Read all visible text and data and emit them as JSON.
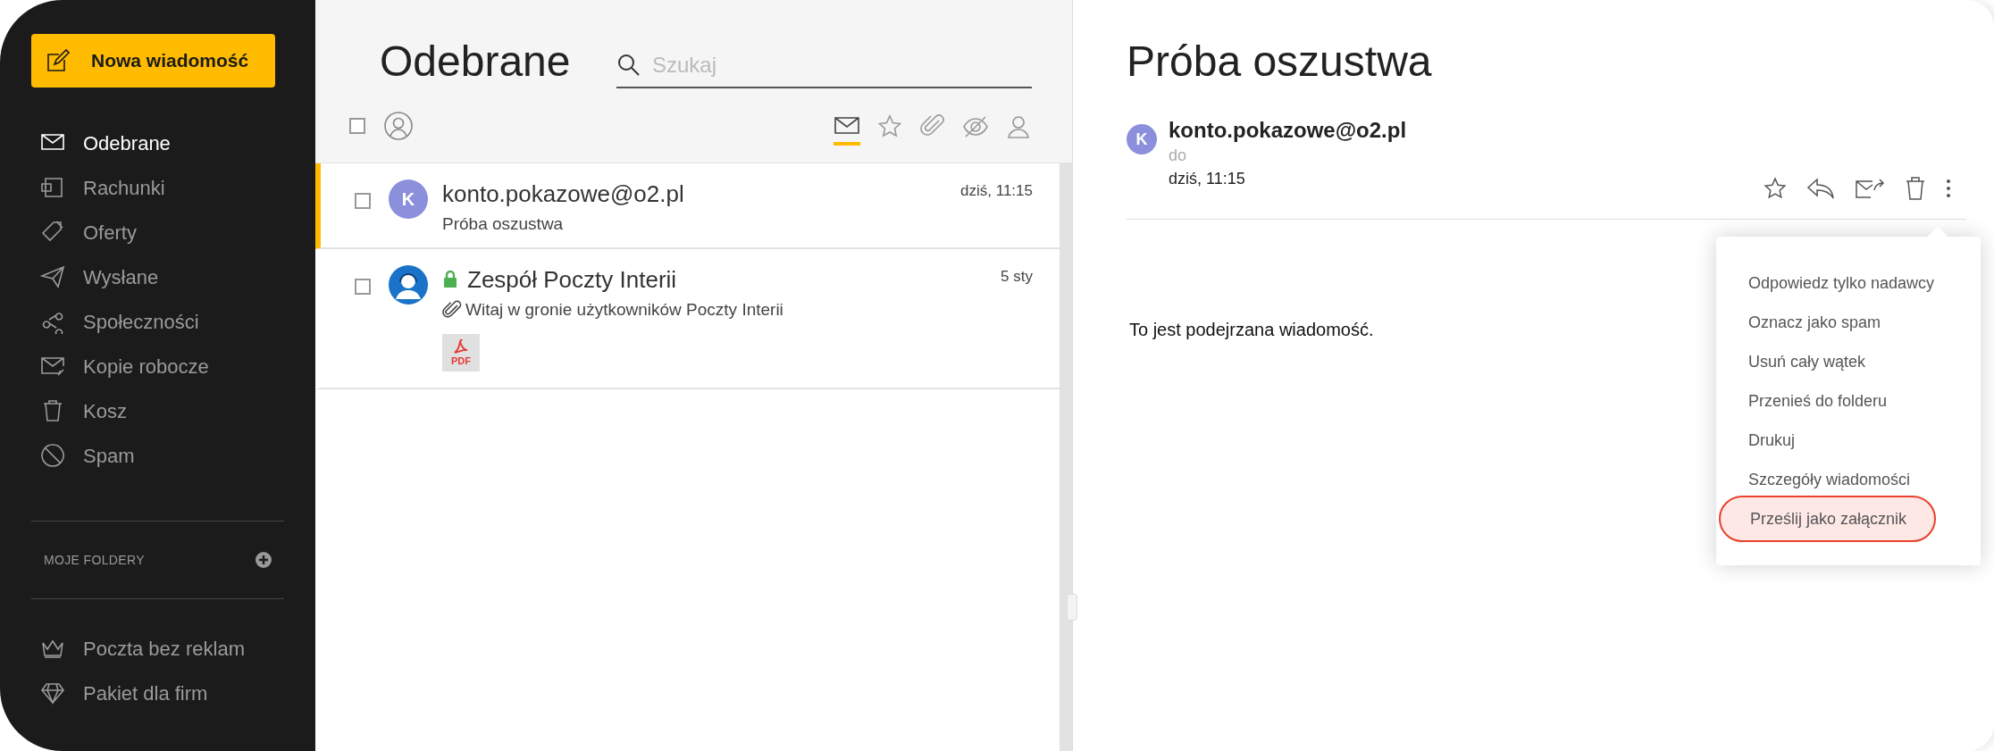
{
  "sidebar": {
    "compose_button": "Nowa wiadomość",
    "items": [
      {
        "label": "Odebrane",
        "selected": true
      },
      {
        "label": "Rachunki",
        "selected": false
      },
      {
        "label": "Oferty",
        "selected": false
      },
      {
        "label": "Wysłane",
        "selected": false
      },
      {
        "label": "Społeczności",
        "selected": false
      },
      {
        "label": "Kopie robocze",
        "selected": false
      },
      {
        "label": "Kosz",
        "selected": false
      },
      {
        "label": "Spam",
        "selected": false
      }
    ],
    "folders_heading": "MOJE FOLDERY",
    "extras": [
      {
        "label": "Poczta bez reklam"
      },
      {
        "label": "Pakiet dla firm"
      }
    ]
  },
  "message_list": {
    "title": "Odebrane",
    "search": {
      "placeholder": "Szukaj"
    },
    "select_all": {
      "checked": false
    },
    "filters": [
      {
        "selected": true
      },
      {
        "selected": false
      },
      {
        "selected": false
      },
      {
        "selected": false
      },
      {
        "selected": false
      }
    ],
    "messages": [
      {
        "sender": "konto.pokazowe@o2.pl",
        "subject": "Próba oszustwa",
        "date": "dziś, 11:15",
        "selected": true,
        "checked": false,
        "avatar_letter": "K",
        "secure": false,
        "has_attachment": false
      },
      {
        "sender": "Zespół Poczty Interii",
        "subject": "Witaj w gronie użytkowników Poczty Interii",
        "date": "5 sty",
        "selected": false,
        "checked": false,
        "secure": true,
        "has_attachment": true,
        "attachment_label": "PDF"
      }
    ]
  },
  "reader": {
    "title": "Próba oszustwa",
    "sender": "konto.pokazowe@o2.pl",
    "avatar_letter": "K",
    "to_label": "do",
    "date": "dziś, 11:15",
    "body": "To jest podejrzana wiadomość.",
    "menu": [
      {
        "label": "Odpowiedz tylko nadawcy",
        "highlighted": false
      },
      {
        "label": "Oznacz jako spam",
        "highlighted": false
      },
      {
        "label": "Usuń cały wątek",
        "highlighted": false
      },
      {
        "label": "Przenieś do folderu",
        "highlighted": false
      },
      {
        "label": "Drukuj",
        "highlighted": false
      },
      {
        "label": "Szczegóły wiadomości",
        "highlighted": false
      },
      {
        "label": "Prześlij jako załącznik",
        "highlighted": true
      }
    ]
  }
}
